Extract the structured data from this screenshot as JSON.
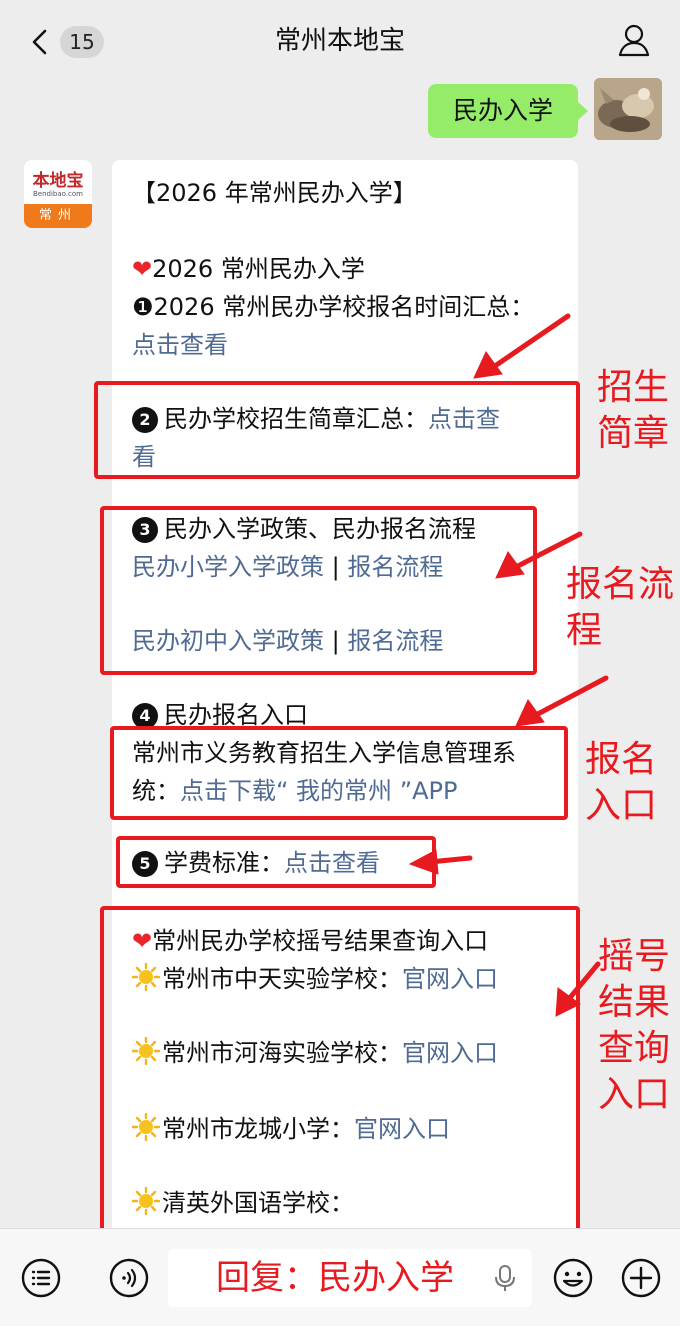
{
  "header": {
    "unread_count": "15",
    "title": "常州本地宝",
    "back_icon": "chevron-left-icon",
    "profile_icon": "person-icon"
  },
  "my_message": {
    "text": "民办入学"
  },
  "sender": {
    "avatar_logo": "本地宝",
    "avatar_domain": "Bendibao.com",
    "avatar_city": "常州"
  },
  "article": {
    "heading": "【2026 年常州民办入学】",
    "s1_heading": "2026 常州民办入学",
    "s1_item_num": "❶",
    "s1_item_text": "2026 常州民办学校报名时间汇总：",
    "s1_item_link": "点击查看",
    "s2_num": "2",
    "s2_text": "民办学校招生简章汇总：",
    "s2_link_1": "点击查",
    "s2_link_2": "看",
    "s3_num": "3",
    "s3_text": "民办入学政策、民办报名流程",
    "s3_primary_policy": "民办小学入学政策",
    "s3_primary_flow": "报名流程",
    "s3_junior_policy": "民办初中入学政策",
    "s3_junior_flow": "报名流程",
    "separator": " | ",
    "s4_num": "4",
    "s4_text": "民办报名入口",
    "s4_system_1": "常州市义务教育招生入学信息管理系",
    "s4_system_2": "统：",
    "s4_link": "点击下载“ 我的常州 ”APP",
    "s5_num": "5",
    "s5_text": "学费标准：",
    "s5_link": "点击查看",
    "lottery_heading": "常州民办学校摇号结果查询入口",
    "school_1": "常州市中天实验学校：",
    "school_2": "常州市河海实验学校：",
    "school_3": "常州市龙城小学：",
    "school_4": "清英外国语学校：",
    "portal_link": "官网入口",
    "heart_glyph": "❤",
    "heart_icon": "heart-icon",
    "sun_icon": "sun-icon"
  },
  "annotations": {
    "label_brochure": "招生\n简章",
    "label_flow": "报名流\n程",
    "label_entry": "报名\n入口",
    "label_lottery": "摇号\n结果\n查询\n入口",
    "color": "#e61a1f"
  },
  "bottom_bar": {
    "input_text": "回复：民办入学",
    "menu_icon": "list-menu-icon",
    "voice_icon": "voice-icon",
    "mic_icon": "microphone-icon",
    "emoji_icon": "smiley-icon",
    "plus_icon": "plus-circle-icon"
  },
  "colors": {
    "bubble_green": "#95ec69",
    "link_blue": "#506b93",
    "background": "#ededed",
    "annotation_red": "#e61a1f"
  }
}
